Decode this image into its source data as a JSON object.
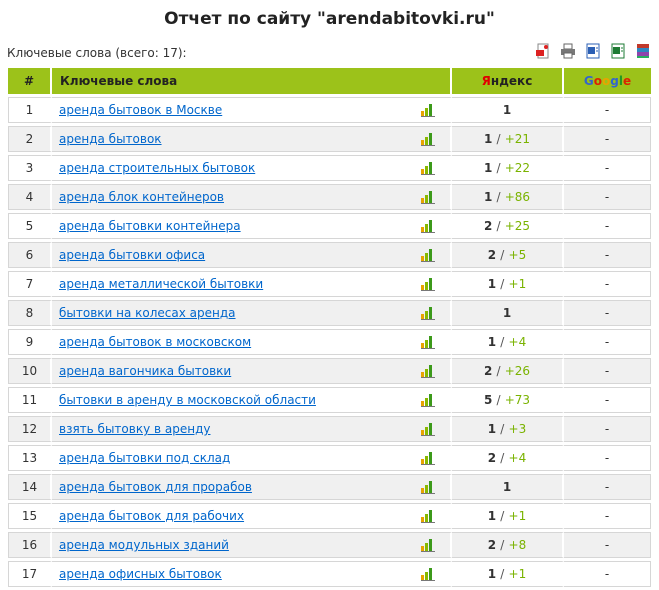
{
  "title": "Отчет по сайту \"arendabitovki.ru\"",
  "subtitle": "Ключевые слова (всего: 17):",
  "toolbar": [
    "pdf-icon",
    "print-icon",
    "word-icon",
    "excel-icon",
    "archive-icon"
  ],
  "table": {
    "headers": {
      "num": "#",
      "keywords": "Ключевые слова",
      "yandex_first": "Я",
      "yandex_rest": "ндекс",
      "google": [
        "G",
        "o",
        "o",
        "g",
        "l",
        "e"
      ]
    },
    "rows": [
      {
        "n": "1",
        "keyword": "аренда бытовок в Москве",
        "yandex": "1",
        "delta": "",
        "google": "-"
      },
      {
        "n": "2",
        "keyword": "аренда бытовок",
        "yandex": "1",
        "delta": "+21",
        "google": "-"
      },
      {
        "n": "3",
        "keyword": "аренда строительных бытовок",
        "yandex": "1",
        "delta": "+22",
        "google": "-"
      },
      {
        "n": "4",
        "keyword": "аренда блок контейнеров",
        "yandex": "1",
        "delta": "+86",
        "google": "-"
      },
      {
        "n": "5",
        "keyword": "аренда бытовки контейнера",
        "yandex": "2",
        "delta": "+25",
        "google": "-"
      },
      {
        "n": "6",
        "keyword": "аренда бытовки офиса",
        "yandex": "2",
        "delta": "+5",
        "google": "-"
      },
      {
        "n": "7",
        "keyword": "аренда металлической бытовки",
        "yandex": "1",
        "delta": "+1",
        "google": "-"
      },
      {
        "n": "8",
        "keyword": "бытовки на колесах аренда",
        "yandex": "1",
        "delta": "",
        "google": "-"
      },
      {
        "n": "9",
        "keyword": "аренда бытовок в московском",
        "yandex": "1",
        "delta": "+4",
        "google": "-"
      },
      {
        "n": "10",
        "keyword": "аренда вагончика бытовки",
        "yandex": "2",
        "delta": "+26",
        "google": "-"
      },
      {
        "n": "11",
        "keyword": "бытовки в аренду в московской области",
        "yandex": "5",
        "delta": "+73",
        "google": "-"
      },
      {
        "n": "12",
        "keyword": "взять бытовку в аренду",
        "yandex": "1",
        "delta": "+3",
        "google": "-"
      },
      {
        "n": "13",
        "keyword": "аренда бытовки под склад",
        "yandex": "2",
        "delta": "+4",
        "google": "-"
      },
      {
        "n": "14",
        "keyword": "аренда бытовок для прорабов",
        "yandex": "1",
        "delta": "",
        "google": "-"
      },
      {
        "n": "15",
        "keyword": "аренда бытовок для рабочих",
        "yandex": "1",
        "delta": "+1",
        "google": "-"
      },
      {
        "n": "16",
        "keyword": "аренда модульных зданий",
        "yandex": "2",
        "delta": "+8",
        "google": "-"
      },
      {
        "n": "17",
        "keyword": "аренда офисных бытовок",
        "yandex": "1",
        "delta": "+1",
        "google": "-"
      }
    ]
  },
  "colors": {
    "header_bg": "#9cc21a",
    "link": "#0066cc",
    "delta": "#7ab300",
    "alt_row": "#f0f0f0"
  }
}
